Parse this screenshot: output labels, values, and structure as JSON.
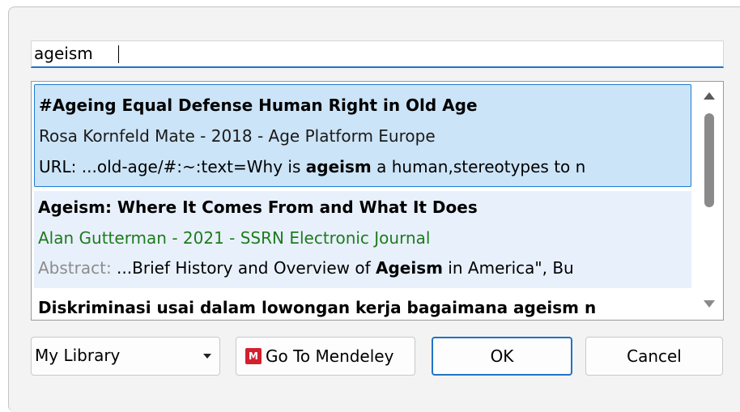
{
  "search": {
    "value": "ageism"
  },
  "results": [
    {
      "title": "#Ageing Equal Defense Human Right in Old Age",
      "meta": "Rosa Kornfeld Mate - 2018 - Age Platform Europe",
      "extra_label": "URL:",
      "extra_pre": " ...old-age/#:~:text=Why is ",
      "extra_keyword": "ageism",
      "extra_post": " a human,stereotypes to n"
    },
    {
      "title": "Ageism: Where It Comes From and What It Does",
      "meta": "Alan Gutterman - 2021 - SSRN Electronic Journal",
      "extra_label": "Abstract:",
      "extra_pre": " ...Brief History and Overview of ",
      "extra_keyword": "Ageism",
      "extra_post": " in America\", Bu"
    },
    {
      "title": "Diskriminasi usai dalam lowongan kerja bagaimana ageism n"
    }
  ],
  "library_select": {
    "selected": "My Library"
  },
  "buttons": {
    "mendeley": "Go To Mendeley",
    "ok": "OK",
    "cancel": "Cancel"
  },
  "icons": {
    "mendeley_logo": "mendeley-logo-icon",
    "scroll_up": "scroll-up-arrow-icon",
    "scroll_down": "scroll-down-arrow-icon",
    "dropdown": "chevron-down-icon"
  },
  "colors": {
    "accent": "#1f73c8",
    "selected_bg": "#cce4f7",
    "hover_bg": "#e8f1fb",
    "meta_green": "#1f7a1f",
    "mendeley_red": "#d2202f"
  }
}
